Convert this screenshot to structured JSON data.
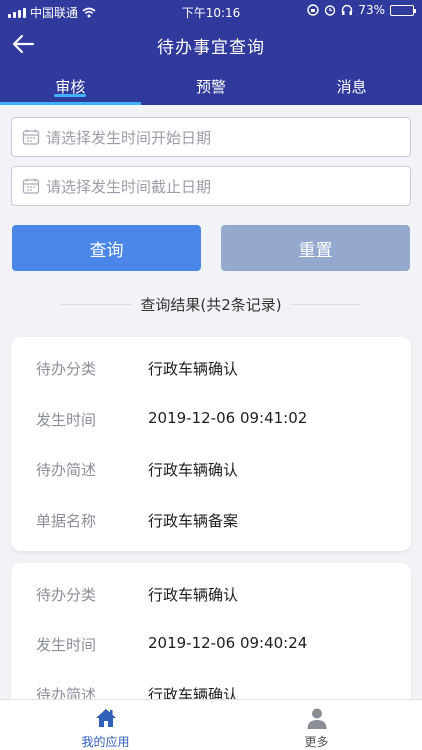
{
  "status_bar": {
    "carrier": "中国联通",
    "time": "下午10:16",
    "battery": "73%",
    "battery_level": 0.73
  },
  "nav": {
    "title": "待办事宜查询"
  },
  "tabs": [
    {
      "label": "审核",
      "active": true
    },
    {
      "label": "预警",
      "active": false
    },
    {
      "label": "消息",
      "active": false
    }
  ],
  "filters": {
    "start_placeholder": "请选择发生时间开始日期",
    "end_placeholder": "请选择发生时间截止日期"
  },
  "buttons": {
    "query": "查询",
    "reset": "重置"
  },
  "results": {
    "summary": "查询结果(共2条记录)",
    "items": [
      {
        "rows": [
          {
            "key": "待办分类",
            "value": "行政车辆确认"
          },
          {
            "key": "发生时间",
            "value": "2019-12-06 09:41:02"
          },
          {
            "key": "待办简述",
            "value": "行政车辆确认"
          },
          {
            "key": "单据名称",
            "value": "行政车辆备案"
          }
        ]
      },
      {
        "rows": [
          {
            "key": "待办分类",
            "value": "行政车辆确认"
          },
          {
            "key": "发生时间",
            "value": "2019-12-06 09:40:24"
          },
          {
            "key": "待办简述",
            "value": "行政车辆确认"
          }
        ]
      }
    ]
  },
  "bottom_nav": [
    {
      "label": "我的应用",
      "icon": "home-icon",
      "active": true
    },
    {
      "label": "更多",
      "icon": "person-icon",
      "active": false
    }
  ],
  "colors": {
    "header": "#2f3a9c",
    "accent": "#3fb1ff",
    "query_button": "#4a87e8",
    "reset_button": "#95a9cf",
    "active_nav": "#2f5fb8",
    "inactive_nav": "#555555"
  }
}
